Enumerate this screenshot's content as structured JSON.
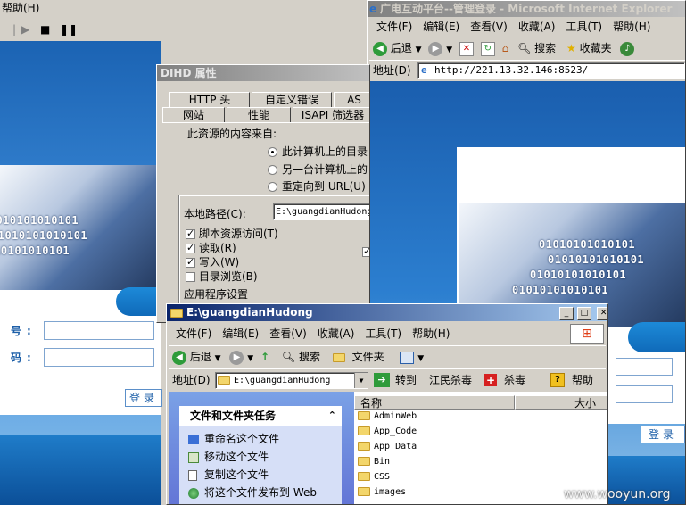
{
  "left_window": {
    "menu_help": "帮助(H)"
  },
  "props_dialog": {
    "title": "DIHD 属性",
    "tabs_row1": [
      "HTTP 头",
      "自定义错误",
      "AS"
    ],
    "tabs_row2": [
      "网站",
      "性能",
      "ISAPI 筛选器"
    ],
    "source_label": "此资源的内容来自:",
    "radio_local": "此计算机上的目录",
    "radio_other": "另一台计算机上的",
    "radio_redirect": "重定向到 URL(U)",
    "local_path_label": "本地路径(C):",
    "local_path_value": "E:\\guangdianHudong",
    "chk_script": "脚本资源访问(T)",
    "chk_read": "读取(R)",
    "chk_write": "写入(W)",
    "chk_browse": "目录浏览(B)",
    "app_settings": "应用程序设置"
  },
  "ie_window": {
    "title": "广电互动平台--管理登录 - Microsoft Internet Explorer",
    "menu": [
      "文件(F)",
      "编辑(E)",
      "查看(V)",
      "收藏(A)",
      "工具(T)",
      "帮助(H)"
    ],
    "back": "后退",
    "search": "搜索",
    "favorites": "收藏夹",
    "address_label": "地址(D)",
    "url": "http://221.13.32.146:8523/"
  },
  "login_page": {
    "label_account": "号:",
    "label_password": "码:",
    "login_button": "登录"
  },
  "explorer_window": {
    "title": "E:\\guangdianHudong",
    "menu": [
      "文件(F)",
      "编辑(E)",
      "查看(V)",
      "收藏(A)",
      "工具(T)",
      "帮助(H)"
    ],
    "back": "后退",
    "search": "搜索",
    "folders": "文件夹",
    "address_label": "地址(D)",
    "address_value": "E:\\guangdianHudong",
    "go": "转到",
    "antivirus": "江民杀毒",
    "kill": "杀毒",
    "help": "帮助",
    "tasks_header": "文件和文件夹任务",
    "tasks": [
      "重命名这个文件",
      "移动这个文件",
      "复制这个文件",
      "将这个文件发布到 Web"
    ],
    "col_name": "名称",
    "col_size": "大小",
    "files": [
      "AdminWeb",
      "App_Code",
      "App_Data",
      "Bin",
      "CSS",
      "images"
    ]
  },
  "watermark": "www.wooyun.org",
  "binary_line": "01010101010101"
}
